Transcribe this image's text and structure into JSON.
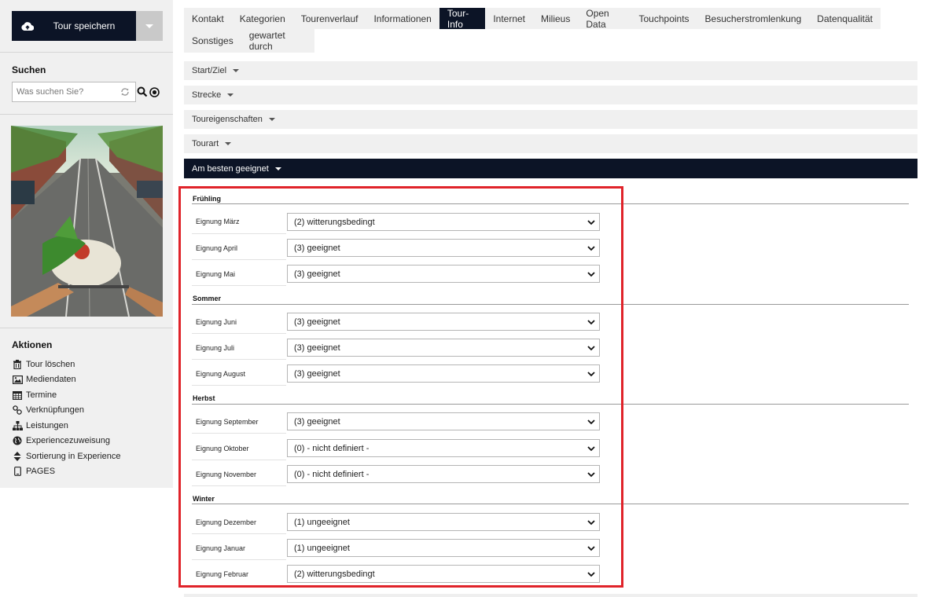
{
  "sidebar": {
    "save_button": {
      "label": "Tour speichern"
    },
    "search": {
      "title": "Suchen",
      "placeholder": "Was suchen Sie?"
    },
    "actions": {
      "title": "Aktionen",
      "items": [
        {
          "label": "Tour löschen",
          "icon": "trash-icon"
        },
        {
          "label": "Mediendaten",
          "icon": "image-icon"
        },
        {
          "label": "Termine",
          "icon": "calendar-icon"
        },
        {
          "label": "Verknüpfungen",
          "icon": "link-icon"
        },
        {
          "label": "Leistungen",
          "icon": "sitemap-icon"
        },
        {
          "label": "Experiencezuweisung",
          "icon": "globe-icon"
        },
        {
          "label": "Sortierung in Experience",
          "icon": "sort-icon"
        },
        {
          "label": "PAGES",
          "icon": "mobile-icon"
        }
      ]
    }
  },
  "tabs": {
    "row1": [
      "Kontakt",
      "Kategorien",
      "Tourenverlauf",
      "Informationen",
      "Tour-Info",
      "Internet",
      "Milieus",
      "Open Data",
      "Touchpoints",
      "Besucherstromlenkung",
      "Datenqualität"
    ],
    "row2": [
      "Sonstiges",
      "gewartet durch"
    ],
    "active": "Tour-Info"
  },
  "accordions": [
    {
      "label": "Start/Ziel"
    },
    {
      "label": "Strecke"
    },
    {
      "label": "Toureigenschaften"
    },
    {
      "label": "Tourart"
    },
    {
      "label": "Am besten geeignet"
    }
  ],
  "seasons": [
    {
      "title": "Frühling",
      "fields": [
        {
          "label": "Eignung März",
          "value": "(2) witterungsbedingt"
        },
        {
          "label": "Eignung April",
          "value": "(3) geeignet"
        },
        {
          "label": "Eignung Mai",
          "value": "(3) geeignet"
        }
      ]
    },
    {
      "title": "Sommer",
      "fields": [
        {
          "label": "Eignung Juni",
          "value": "(3) geeignet"
        },
        {
          "label": "Eignung Juli",
          "value": "(3) geeignet"
        },
        {
          "label": "Eignung August",
          "value": "(3) geeignet"
        }
      ]
    },
    {
      "title": "Herbst",
      "fields": [
        {
          "label": "Eignung September",
          "value": "(3) geeignet"
        },
        {
          "label": "Eignung Oktober",
          "value": "(0) - nicht definiert -"
        },
        {
          "label": "Eignung November",
          "value": "(0) - nicht definiert -"
        }
      ]
    },
    {
      "title": "Winter",
      "fields": [
        {
          "label": "Eignung Dezember",
          "value": "(1) ungeeignet"
        },
        {
          "label": "Eignung Januar",
          "value": "(1) ungeeignet"
        },
        {
          "label": "Eignung Februar",
          "value": "(2) witterungsbedingt"
        }
      ]
    }
  ],
  "colors": {
    "dark": "#0c1426",
    "highlight": "#e0232a",
    "panel": "#f0f0f0"
  }
}
